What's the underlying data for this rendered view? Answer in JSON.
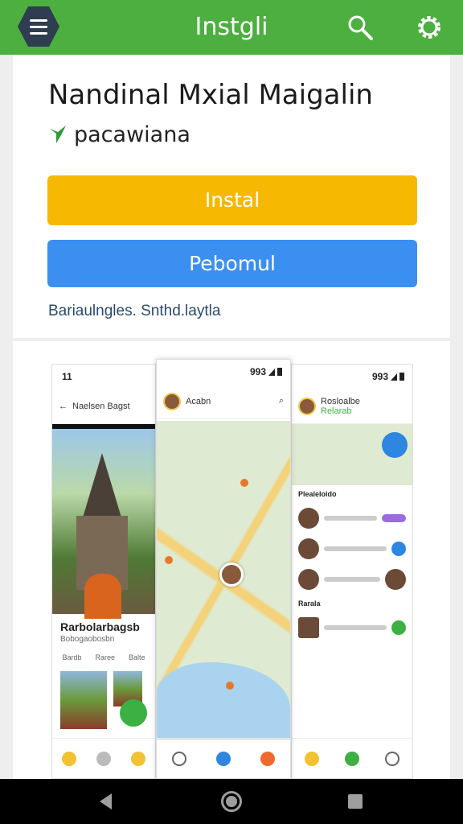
{
  "appbar": {
    "title": "Instgli",
    "menu_icon": "menu-icon",
    "search_icon": "search-icon",
    "settings_icon": "gear-icon",
    "color": "#4caf3f"
  },
  "app": {
    "name": "Nandinal Mxial Maigalin",
    "developer": "pacawiana",
    "developer_icon": "leaf-icon",
    "install_label": "Instal",
    "secondary_label": "Pebomul",
    "info_text": "Bariaulngles. Snthd.laytla",
    "install_color": "#f6b800",
    "secondary_color": "#3b8ff0"
  },
  "screenshots": {
    "phone1": {
      "status": "11",
      "header": "Naelsen Bagst",
      "title": "Rarbolarbagsb",
      "subtitle": "Bobogaobosbn",
      "tabs": [
        "Bardb",
        "Raree",
        "Balte"
      ]
    },
    "phone2": {
      "status": "993",
      "header": "Acabn"
    },
    "phone3": {
      "status": "993",
      "header": "Rosloalbe",
      "subheader": "Relarab",
      "section1": "Plealeloido",
      "section2": "Rarala"
    }
  },
  "sysnav": {
    "back_icon": "back-icon",
    "home_icon": "home-icon",
    "recents_icon": "recents-icon"
  }
}
